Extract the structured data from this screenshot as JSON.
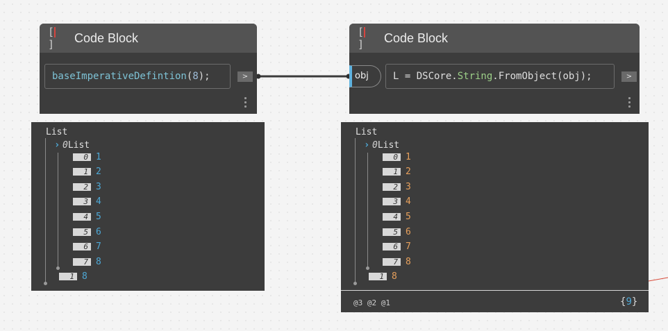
{
  "node1": {
    "title": "Code Block",
    "code_fn": "baseImperativeDefintion",
    "code_open": "(",
    "code_arg": "8",
    "code_close": ");",
    "output_port": ">"
  },
  "node2": {
    "title": "Code Block",
    "input_port": "obj",
    "code_lhs": "L = DSCore.",
    "code_cls": "String",
    "code_rest": ".FromObject(obj);",
    "output_port": ">"
  },
  "preview1": {
    "root_label": "List",
    "sub_index": "0",
    "sub_label": "List",
    "items": [
      {
        "index": "0",
        "value": "1"
      },
      {
        "index": "1",
        "value": "2"
      },
      {
        "index": "2",
        "value": "3"
      },
      {
        "index": "3",
        "value": "4"
      },
      {
        "index": "4",
        "value": "5"
      },
      {
        "index": "5",
        "value": "6"
      },
      {
        "index": "6",
        "value": "7"
      },
      {
        "index": "7",
        "value": "8"
      }
    ],
    "second": {
      "index": "1",
      "value": "8"
    }
  },
  "preview2": {
    "root_label": "List",
    "sub_index": "0",
    "sub_label": "List",
    "items": [
      {
        "index": "0",
        "value": "1"
      },
      {
        "index": "1",
        "value": "2"
      },
      {
        "index": "2",
        "value": "3"
      },
      {
        "index": "3",
        "value": "4"
      },
      {
        "index": "4",
        "value": "5"
      },
      {
        "index": "5",
        "value": "6"
      },
      {
        "index": "6",
        "value": "7"
      },
      {
        "index": "7",
        "value": "8"
      }
    ],
    "second": {
      "index": "1",
      "value": "8"
    },
    "levels": "@3 @2 @1",
    "count_open": "{",
    "count": "9",
    "count_close": "}"
  },
  "colors": {
    "number_value": "#4ea8d6",
    "string_value": "#e7a05c",
    "input_port_accent": "#5fb3e0",
    "error_bar": "#d6453f"
  }
}
